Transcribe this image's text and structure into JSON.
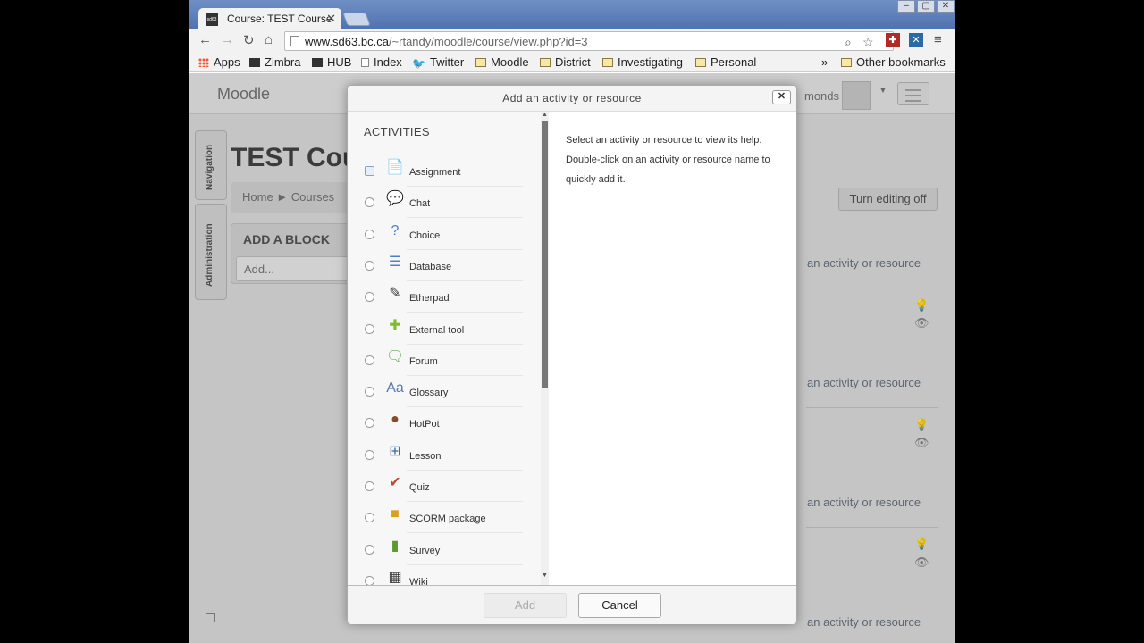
{
  "browser": {
    "tab_title": "Course: TEST Course",
    "url_host": "www.sd63.bc.ca",
    "url_path": "/~rtandy/moodle/course/view.php?id=3",
    "bookmarks": [
      "Apps",
      "Zimbra",
      "HUB",
      "Index",
      "Twitter",
      "Moodle",
      "District",
      "Investigating",
      "Personal"
    ],
    "more_bookmarks": "»",
    "other_bookmarks": "Other bookmarks"
  },
  "page": {
    "brand": "Moodle",
    "user_name": "monds",
    "course_title": "TEST Cou",
    "breadcrumb": "Home ► Courses",
    "nav_dock": "Navigation",
    "admin_dock": "Administration",
    "add_block_heading": "ADD A BLOCK",
    "add_block_placeholder": "Add...",
    "edit_button": "Turn editing off",
    "add_activity_link": "an activity or resource"
  },
  "modal": {
    "title": "Add an activity or resource",
    "close": "✕",
    "activities_heading": "ACTIVITIES",
    "activities": [
      {
        "label": "Assignment",
        "icon": "assignment-icon",
        "glyph": "📄",
        "selected": true
      },
      {
        "label": "Chat",
        "icon": "chat-icon",
        "glyph": "💬",
        "selected": false
      },
      {
        "label": "Choice",
        "icon": "choice-icon",
        "glyph": "?",
        "selected": false
      },
      {
        "label": "Database",
        "icon": "database-icon",
        "glyph": "☰",
        "selected": false
      },
      {
        "label": "Etherpad",
        "icon": "etherpad-icon",
        "glyph": "✎",
        "selected": false
      },
      {
        "label": "External tool",
        "icon": "external-tool-icon",
        "glyph": "✚",
        "selected": false
      },
      {
        "label": "Forum",
        "icon": "forum-icon",
        "glyph": "🗨",
        "selected": false
      },
      {
        "label": "Glossary",
        "icon": "glossary-icon",
        "glyph": "Aa",
        "selected": false
      },
      {
        "label": "HotPot",
        "icon": "hotpot-icon",
        "glyph": "●",
        "selected": false
      },
      {
        "label": "Lesson",
        "icon": "lesson-icon",
        "glyph": "⊞",
        "selected": false
      },
      {
        "label": "Quiz",
        "icon": "quiz-icon",
        "glyph": "✔",
        "selected": false
      },
      {
        "label": "SCORM package",
        "icon": "scorm-package-icon",
        "glyph": "■",
        "selected": false
      },
      {
        "label": "Survey",
        "icon": "survey-icon",
        "glyph": "▮",
        "selected": false
      },
      {
        "label": "Wiki",
        "icon": "wiki-icon",
        "glyph": "▦",
        "selected": false
      }
    ],
    "help_lines": [
      "Select an activity or resource to view its help.",
      "Double-click on an activity or resource name to",
      "quickly add it."
    ],
    "add_button": "Add",
    "cancel_button": "Cancel"
  }
}
